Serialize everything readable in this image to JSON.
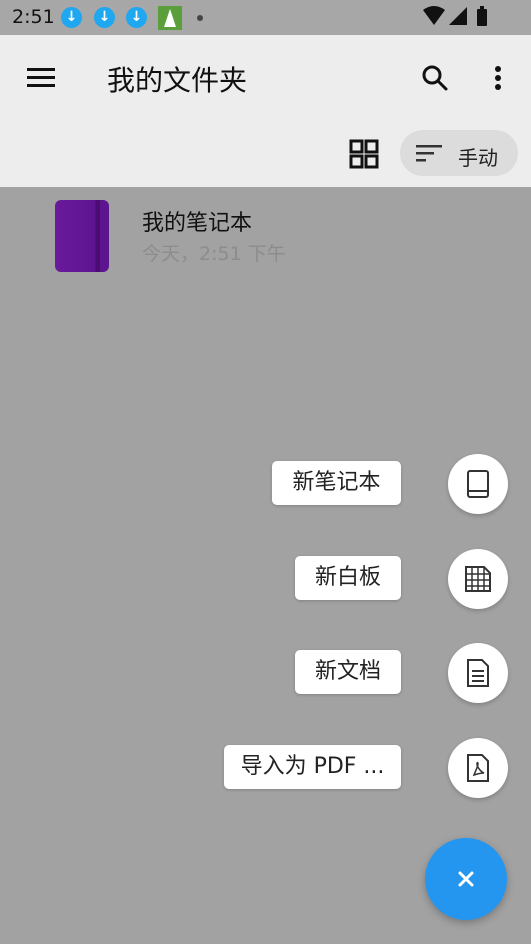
{
  "status_bar": {
    "time": "2:51"
  },
  "app_bar": {
    "title": "我的文件夹"
  },
  "sort": {
    "label": "手动"
  },
  "files": [
    {
      "name": "我的笔记本",
      "date": "今天，2:51 下午"
    }
  ],
  "fab_menu": {
    "new_notebook": "新笔记本",
    "new_whiteboard": "新白板",
    "new_document": "新文档",
    "import_pdf": "导入为 PDF ..."
  },
  "colors": {
    "accent": "#2596ef",
    "notebook": "#6a1a9c"
  }
}
